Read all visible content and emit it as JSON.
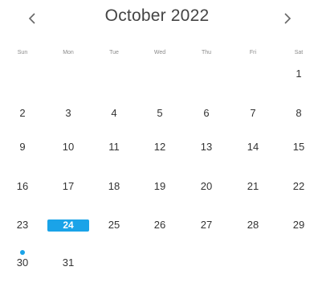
{
  "header": {
    "title": "October 2022",
    "prev_icon": "chevron-left-icon",
    "next_icon": "chevron-right-icon"
  },
  "weekdays": [
    "Sun",
    "Mon",
    "Tue",
    "Wed",
    "Thu",
    "Fri",
    "Sat"
  ],
  "weeks": [
    [
      "",
      "",
      "",
      "",
      "",
      "",
      "1"
    ],
    [
      "2",
      "3",
      "4",
      "5",
      "6",
      "7",
      "8"
    ],
    [
      "9",
      "10",
      "11",
      "12",
      "13",
      "14",
      "15"
    ],
    [
      "16",
      "17",
      "18",
      "19",
      "20",
      "21",
      "22"
    ],
    [
      "23",
      "24",
      "25",
      "26",
      "27",
      "28",
      "29"
    ],
    [
      "30",
      "31",
      "",
      "",
      "",
      "",
      ""
    ]
  ],
  "selected_day": "24",
  "event_day": "30",
  "colors": {
    "accent": "#1aa3e8",
    "text": "#333333",
    "weekday": "#8a8a8a"
  }
}
